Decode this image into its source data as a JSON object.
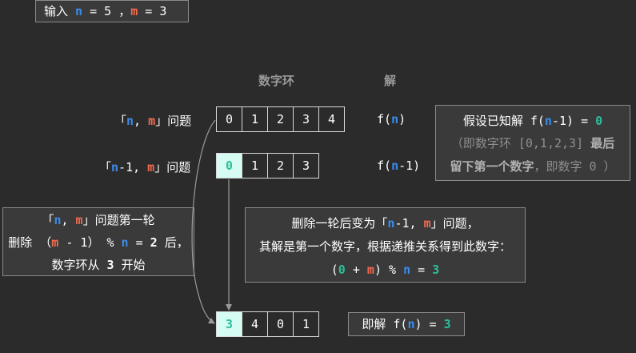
{
  "input": {
    "prefix": "输入 ",
    "n_sym": "n",
    "eq1": " = 5 ，",
    "m_sym": "m",
    "eq2": " = 3"
  },
  "headers": {
    "ring": "数字环",
    "solution": "解"
  },
  "row1": {
    "label_open": "「",
    "n": "n",
    "comma": ", ",
    "m": "m",
    "label_close": "」问题",
    "cells": [
      "0",
      "1",
      "2",
      "3",
      "4"
    ],
    "sol_pre": "f(",
    "sol_n": "n",
    "sol_post": ")"
  },
  "row2": {
    "label_open": "「",
    "n": "n",
    "minus": "-1, ",
    "m": "m",
    "label_close": "」问题",
    "cells": [
      "0",
      "1",
      "2",
      "3"
    ],
    "sol_pre": "f(",
    "sol_n": "n",
    "sol_post": "-1)"
  },
  "assume_box": {
    "l1_pre": "假设已知解 f(",
    "l1_n": "n",
    "l1_mid": "-1) = ",
    "l1_val": "0",
    "l2_pre": "（即数字环 [0,1,2,3] ",
    "l2_bold": "最后",
    "l3_bold": "留下第一个数字",
    "l3_post": "，即数字 0 ）"
  },
  "left_box": {
    "l1_open": "「",
    "l1_n": "n",
    "l1_comma": ", ",
    "l1_m": "m",
    "l1_close": "」问题第一轮",
    "l2_pre": "删除 （",
    "l2_m": "m",
    "l2_mid": " - 1） % ",
    "l2_n": "n",
    "l2_eq": " = ",
    "l2_val": "2",
    "l2_post": " 后，",
    "l3_pre": "数字环从 ",
    "l3_val": "3",
    "l3_post": " 开始"
  },
  "mid_box": {
    "l1_pre": "删除一轮后变为「",
    "l1_n": "n",
    "l1_mid": "-1, ",
    "l1_m": "m",
    "l1_post": "」问题，",
    "l2": "其解是第一个数字，根据递推关系得到此数字：",
    "l3_open": "(",
    "l3_g": "0",
    "l3_plus": " + ",
    "l3_m": "m",
    "l3_mod": ") % ",
    "l3_n": "n",
    "l3_eq": " = ",
    "l3_val": "3"
  },
  "row3": {
    "cells": [
      "3",
      "4",
      "0",
      "1"
    ]
  },
  "result": {
    "pre": "即解 f(",
    "n": "n",
    "mid": ") = ",
    "val": "3"
  },
  "colors": {
    "n": "#3b8bea",
    "m": "#f26b4f",
    "green": "#2bbf9a",
    "highlight": "#d6fbf3",
    "background": "#2b2b2b"
  }
}
